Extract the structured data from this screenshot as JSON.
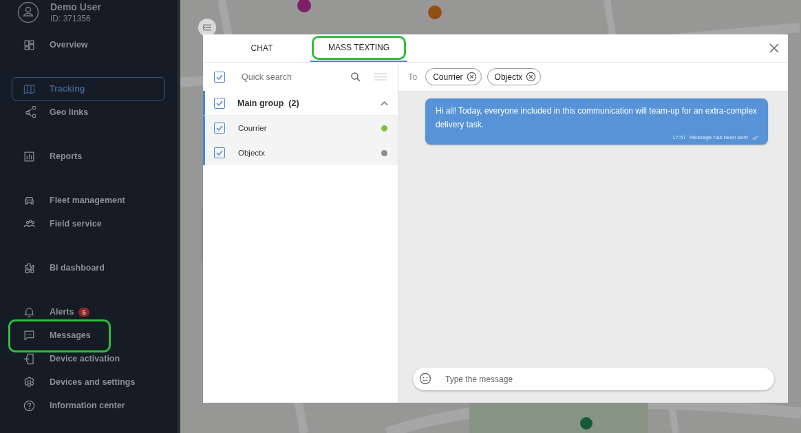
{
  "user": {
    "name": "Demo User",
    "id": "ID: 371356"
  },
  "sidebar": {
    "groups": [
      {
        "items": [
          {
            "label": "Overview",
            "selected": false,
            "highlighted": false
          }
        ]
      },
      {
        "items": [
          {
            "label": "Tracking",
            "selected": true,
            "highlighted": false
          },
          {
            "label": "Geo links",
            "selected": false,
            "highlighted": false
          }
        ]
      },
      {
        "items": [
          {
            "label": "Reports",
            "selected": false,
            "highlighted": false
          }
        ]
      },
      {
        "items": [
          {
            "label": "Fleet management",
            "selected": false,
            "highlighted": false
          },
          {
            "label": "Field service",
            "selected": false,
            "highlighted": false
          }
        ]
      },
      {
        "items": [
          {
            "label": "BI dashboard",
            "selected": false,
            "highlighted": false
          }
        ]
      },
      {
        "items": [
          {
            "label": "Alerts",
            "selected": false,
            "highlighted": false,
            "badge": "5"
          },
          {
            "label": "Messages",
            "selected": false,
            "highlighted": true
          },
          {
            "label": "Device activation",
            "selected": false,
            "highlighted": false
          },
          {
            "label": "Devices and settings",
            "selected": false,
            "highlighted": false
          },
          {
            "label": "Information center",
            "selected": false,
            "highlighted": false
          }
        ]
      }
    ]
  },
  "dialog": {
    "tabs": [
      {
        "label": "CHAT",
        "selected": false,
        "highlighted": false
      },
      {
        "label": "MASS TEXTING",
        "selected": true,
        "highlighted": true
      }
    ],
    "search": {
      "placeholder": "Quick search",
      "checked": true
    },
    "group": {
      "label": "Main group  (2)",
      "checked": true,
      "expanded": true,
      "children": [
        {
          "name": "Courrier",
          "checked": true,
          "color": "#7cc242"
        },
        {
          "name": "Objectx",
          "checked": true,
          "color": "#8c8c8c"
        }
      ]
    },
    "to_label": "To",
    "recipients": [
      "Courrier",
      "Objectx"
    ],
    "messages": [
      {
        "text": "Hi all! Today, everyone included in this communication will team-up for an extra-complex delivery task.",
        "time": "17:57",
        "status": "Message has been sent"
      }
    ],
    "composer": {
      "placeholder": "Type the message"
    }
  }
}
